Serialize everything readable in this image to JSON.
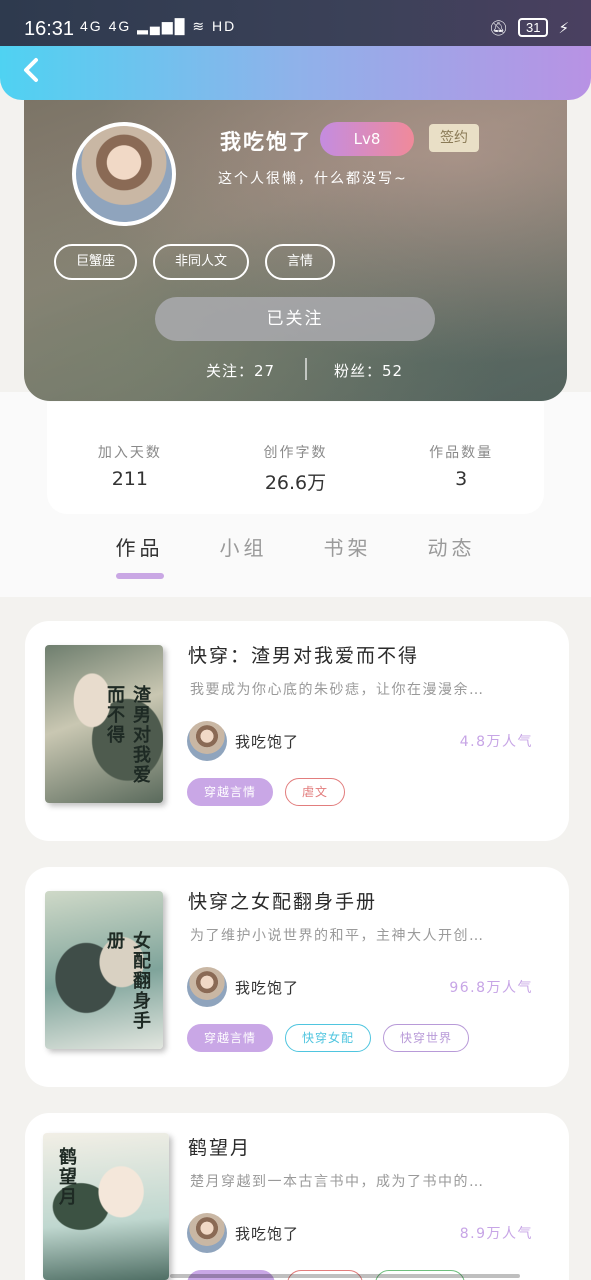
{
  "status_bar": {
    "time": "16:31",
    "network": "4G 4G",
    "hd": "HD",
    "battery": "31"
  },
  "profile": {
    "username": "我吃饱了",
    "level": "Lv8",
    "signed": "签约",
    "bio": "这个人很懒，什么都没写~",
    "tags": [
      "巨蟹座",
      "非同人文",
      "言情"
    ],
    "follow_button": "已关注",
    "following": "关注：27",
    "fans": "粉丝：52"
  },
  "stats": [
    {
      "label": "加入天数",
      "value": "211"
    },
    {
      "label": "创作字数",
      "value": "26.6万"
    },
    {
      "label": "作品数量",
      "value": "3"
    }
  ],
  "tabs": [
    "作品",
    "小组",
    "书架",
    "动态"
  ],
  "books": [
    {
      "title": "快穿：渣男对我爱而不得",
      "desc": "我要成为你心底的朱砂痣，让你在漫漫余…",
      "author": "我吃饱了",
      "popularity": "4.8万人气",
      "cover_text": "渣男对我爱而不得",
      "tags": [
        {
          "label": "穿越言情",
          "style": "purple"
        },
        {
          "label": "虐文",
          "style": "red"
        }
      ]
    },
    {
      "title": "快穿之女配翻身手册",
      "desc": "为了维护小说世界的和平，主神大人开创…",
      "author": "我吃饱了",
      "popularity": "96.8万人气",
      "cover_text": "女配翻身手册",
      "tags": [
        {
          "label": "穿越言情",
          "style": "purple"
        },
        {
          "label": "快穿女配",
          "style": "cyan"
        },
        {
          "label": "快穿世界",
          "style": "lilac"
        }
      ]
    },
    {
      "title": "鹤望月",
      "desc": "楚月穿越到一本古言书中，成为了书中的…",
      "author": "我吃饱了",
      "popularity": "8.9万人气",
      "cover_text": "鹤望月",
      "tags": [
        {
          "label": "",
          "style": "purple"
        },
        {
          "label": "",
          "style": "red"
        },
        {
          "label": "",
          "style": "green"
        }
      ]
    }
  ],
  "colors": {
    "accent": "#c9a7e6",
    "header_start": "#4fd2f2",
    "header_end": "#b892e4"
  }
}
